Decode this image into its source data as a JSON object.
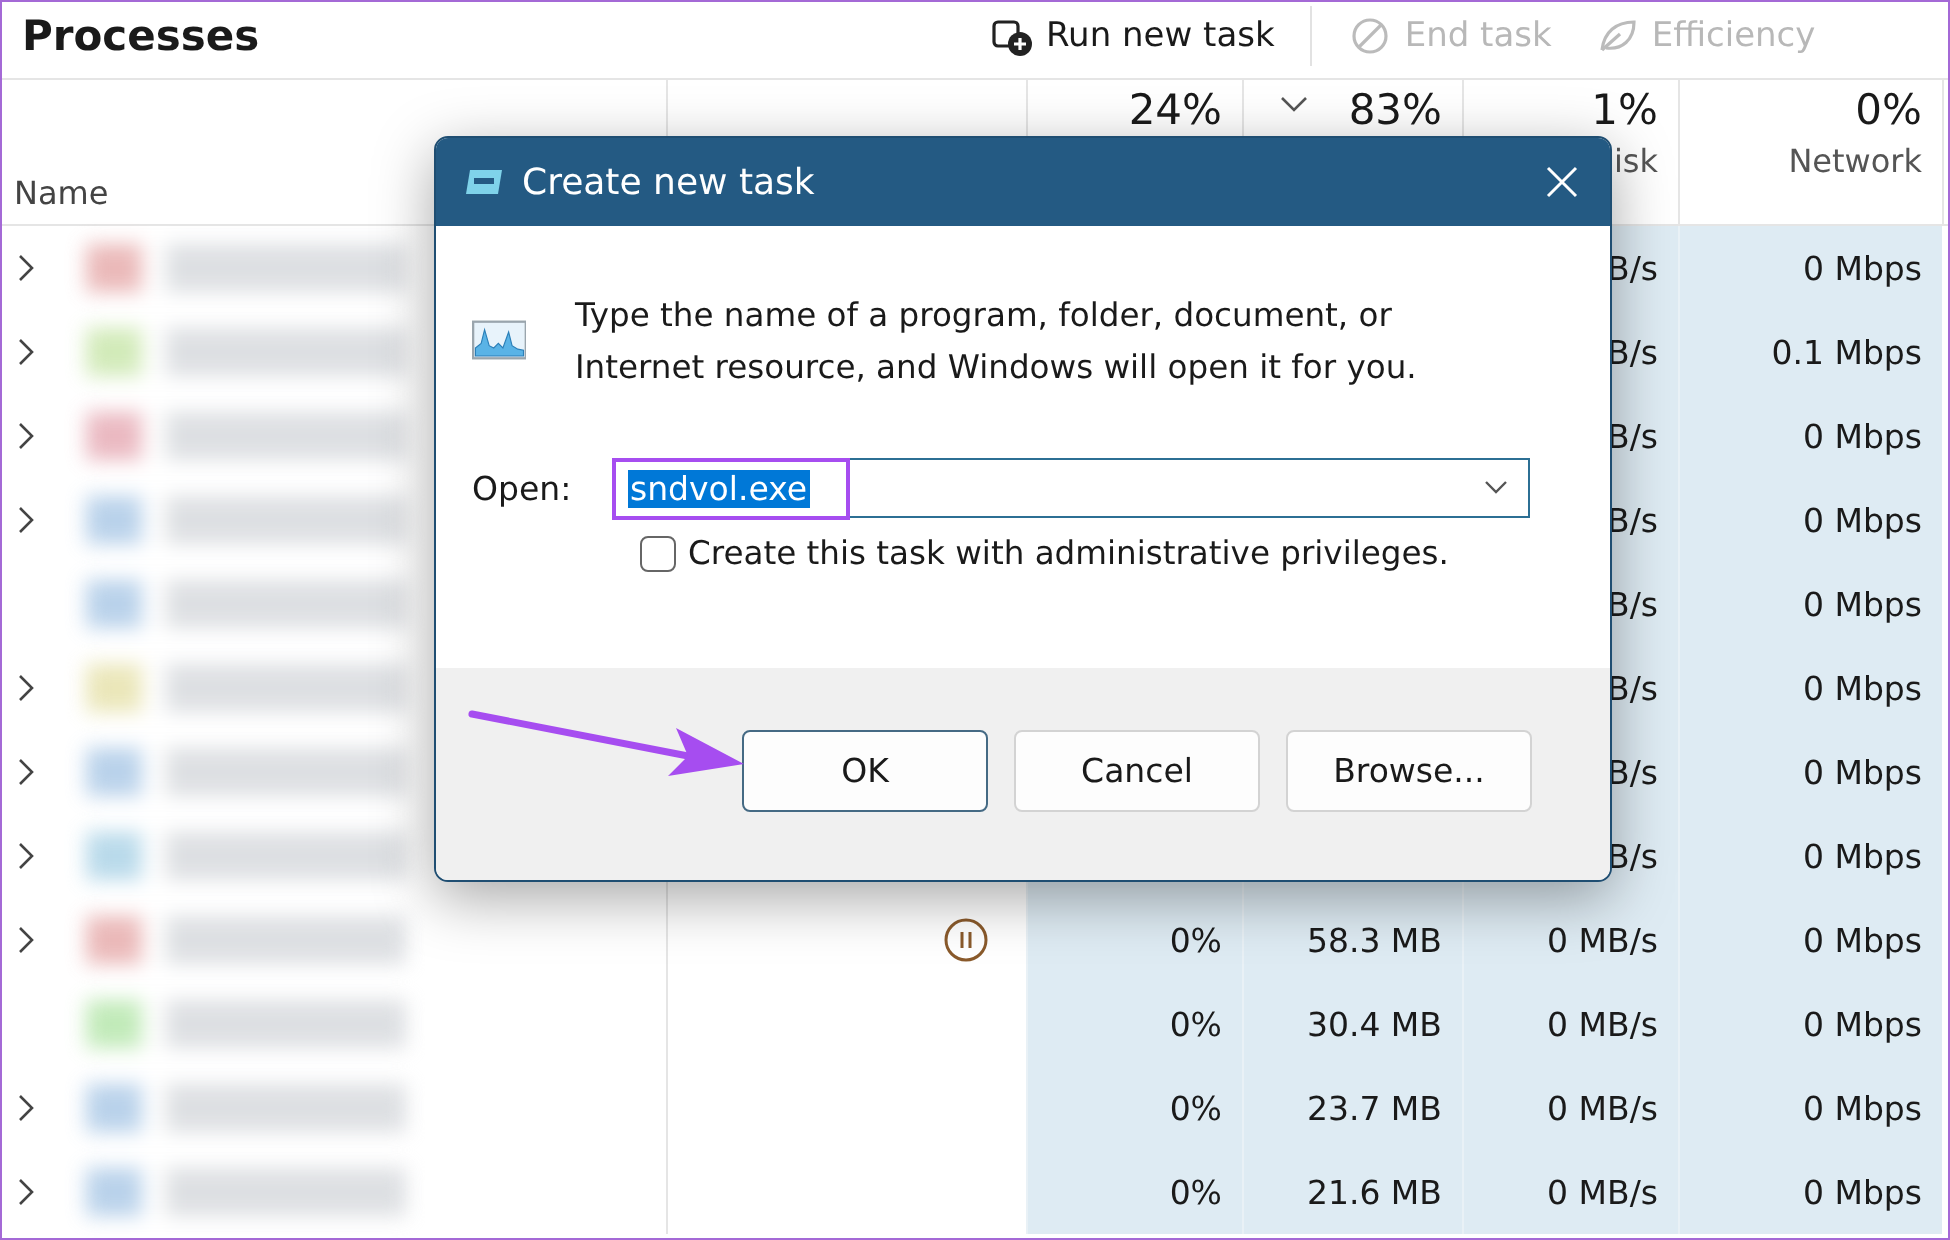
{
  "title": "Processes",
  "toolbar": [
    {
      "label": "Run new task",
      "kind": "run",
      "disabled": false
    },
    {
      "label": "End task",
      "kind": "end",
      "disabled": true
    },
    {
      "label": "Efficiency",
      "kind": "leaf",
      "disabled": true
    }
  ],
  "columns": [
    {
      "label": "Name"
    },
    {
      "percent": "24%"
    },
    {
      "percent": "83%",
      "sorted": true
    },
    {
      "percent": "1%",
      "label": "isk"
    },
    {
      "percent": "0%",
      "label": "Network"
    }
  ],
  "rows": [
    {
      "expandable": true,
      "disk": "B/s",
      "network": "0 Mbps"
    },
    {
      "expandable": true,
      "disk": "B/s",
      "network": "0.1 Mbps"
    },
    {
      "expandable": true,
      "disk": "B/s",
      "network": "0 Mbps"
    },
    {
      "expandable": true,
      "disk": "B/s",
      "network": "0 Mbps"
    },
    {
      "expandable": false,
      "disk": "B/s",
      "network": "0 Mbps"
    },
    {
      "expandable": true,
      "disk": "B/s",
      "network": "0 Mbps"
    },
    {
      "expandable": true,
      "disk": "B/s",
      "network": "0 Mbps"
    },
    {
      "expandable": true,
      "disk": "B/s",
      "network": "0 Mbps"
    },
    {
      "expandable": true,
      "suspended": true,
      "cpu": "0%",
      "memory": "58.3 MB",
      "disk": "0 MB/s",
      "network": "0 Mbps"
    },
    {
      "expandable": false,
      "suspended": false,
      "cpu": "0%",
      "memory": "30.4 MB",
      "disk": "0 MB/s",
      "network": "0 Mbps"
    },
    {
      "expandable": true,
      "suspended": false,
      "cpu": "0%",
      "memory": "23.7 MB",
      "disk": "0 MB/s",
      "network": "0 Mbps"
    },
    {
      "expandable": true,
      "suspended": false,
      "cpu": "0%",
      "memory": "21.6 MB",
      "disk": "0 MB/s",
      "network": "0 Mbps"
    }
  ],
  "dialog": {
    "title": "Create new task",
    "message": "Type the name of a program, folder, document, or Internet resource, and Windows will open it for you.",
    "open_label": "Open:",
    "open_value": "sndvol.exe",
    "value_selected": true,
    "checkbox": {
      "label": "Create this task with administrative privileges.",
      "checked": false
    },
    "buttons": [
      {
        "label": "OK",
        "default": true
      },
      {
        "label": "Cancel",
        "default": false
      },
      {
        "label": "Browse...",
        "default": false
      }
    ]
  }
}
